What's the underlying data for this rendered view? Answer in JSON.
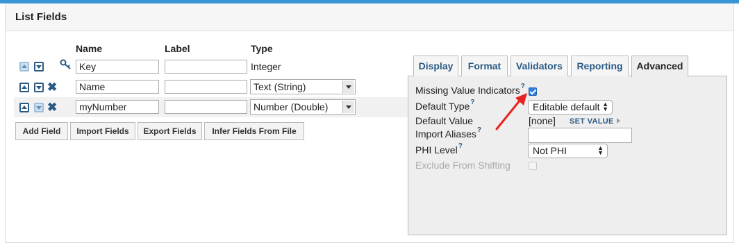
{
  "panel": {
    "title": "List Fields"
  },
  "columns": {
    "name": "Name",
    "label": "Label",
    "type": "Type"
  },
  "fields": [
    {
      "name": "Key",
      "label": "",
      "type": "Integer"
    },
    {
      "name": "Name",
      "label": "",
      "type": "Text (String)"
    },
    {
      "name": "myNumber",
      "label": "",
      "type": "Number (Double)"
    }
  ],
  "buttons": {
    "add_field": "Add Field",
    "import_fields": "Import Fields",
    "export_fields": "Export Fields",
    "infer_fields": "Infer Fields From File"
  },
  "tabs": [
    "Display",
    "Format",
    "Validators",
    "Reporting",
    "Advanced"
  ],
  "active_tab": "Advanced",
  "advanced": {
    "missing_value_indicators": {
      "label": "Missing Value Indicators",
      "help": "?",
      "checked": true
    },
    "default_type": {
      "label": "Default Type",
      "help": "?",
      "value": "Editable default"
    },
    "default_value": {
      "label": "Default Value",
      "value": "[none]",
      "action": "SET VALUE"
    },
    "import_aliases": {
      "label": "Import Aliases",
      "help": "?",
      "value": ""
    },
    "phi_level": {
      "label": "PHI Level",
      "help": "?",
      "value": "Not PHI"
    },
    "exclude_from_shifting": {
      "label": "Exclude From Shifting",
      "checked": false,
      "disabled": true
    }
  },
  "colors": {
    "accent": "#2b5b85",
    "topbar": "#3a95d5",
    "annotation_arrow": "#e8231f",
    "checkbox": "#2f7fe0"
  }
}
